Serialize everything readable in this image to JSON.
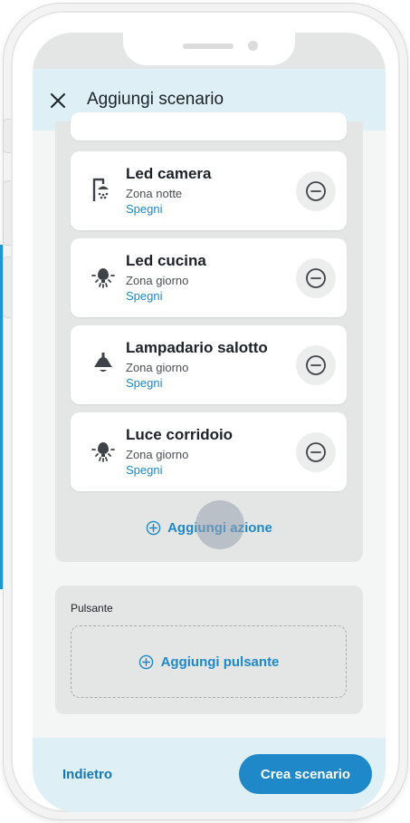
{
  "header": {
    "title": "Aggiungi scenario"
  },
  "actions": [
    {
      "name": "Led camera",
      "zone": "Zona notte",
      "state": "Spegni",
      "icon": "shower-light-icon"
    },
    {
      "name": "Led cucina",
      "zone": "Zona giorno",
      "state": "Spegni",
      "icon": "bulb-icon"
    },
    {
      "name": "Lampadario salotto",
      "zone": "Zona giorno",
      "state": "Spegni",
      "icon": "chandelier-icon"
    },
    {
      "name": "Luce corridoio",
      "zone": "Zona giorno",
      "state": "Spegni",
      "icon": "bulb-icon"
    }
  ],
  "add_action_label": "Aggiungi azione",
  "button_section": {
    "label": "Pulsante",
    "add_label": "Aggiungi pulsante"
  },
  "footer": {
    "back_label": "Indietro",
    "create_label": "Crea scenario"
  },
  "colors": {
    "accent": "#1e88c8",
    "header_bg": "#def0f6",
    "panel_bg": "#e4e6e6"
  }
}
